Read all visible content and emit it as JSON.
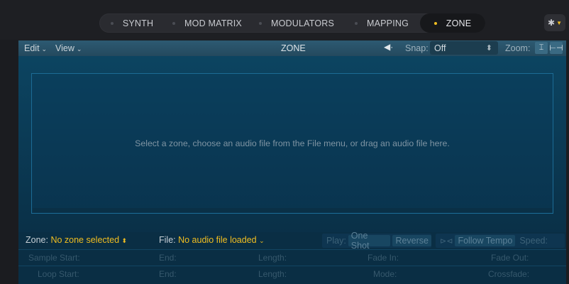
{
  "tabs": [
    {
      "label": "SYNTH",
      "active": false
    },
    {
      "label": "MOD MATRIX",
      "active": false
    },
    {
      "label": "MODULATORS",
      "active": false
    },
    {
      "label": "MAPPING",
      "active": false
    },
    {
      "label": "ZONE",
      "active": true
    }
  ],
  "colors": {
    "accent": "#f1be21",
    "panel": "#0b3c57"
  },
  "toolbar": {
    "edit_label": "Edit",
    "view_label": "View",
    "title": "ZONE",
    "snap_label": "Snap:",
    "snap_value": "Off",
    "zoom_label": "Zoom:"
  },
  "drop_area": {
    "message": "Select a zone, choose an audio file from the File menu, or drag an audio file here."
  },
  "params": {
    "zone_label": "Zone:",
    "zone_value": "No zone selected",
    "file_label": "File:",
    "file_value": "No audio file loaded",
    "play_label": "Play:",
    "one_shot_label": "One Shot",
    "reverse_label": "Reverse",
    "follow_tempo_label": "Follow Tempo",
    "speed_label": "Speed:",
    "sample_start_label": "Sample Start:",
    "end_label": "End:",
    "length_label": "Length:",
    "fade_in_label": "Fade In:",
    "fade_out_label": "Fade Out:",
    "loop_start_label": "Loop Start:",
    "mode_label": "Mode:",
    "crossfade_label": "Crossfade:"
  },
  "icons": [
    "settings-gear-icon",
    "speaker-icon",
    "zoom-vertical-icon",
    "zoom-horizontal-icon",
    "follow-tempo-icon"
  ]
}
